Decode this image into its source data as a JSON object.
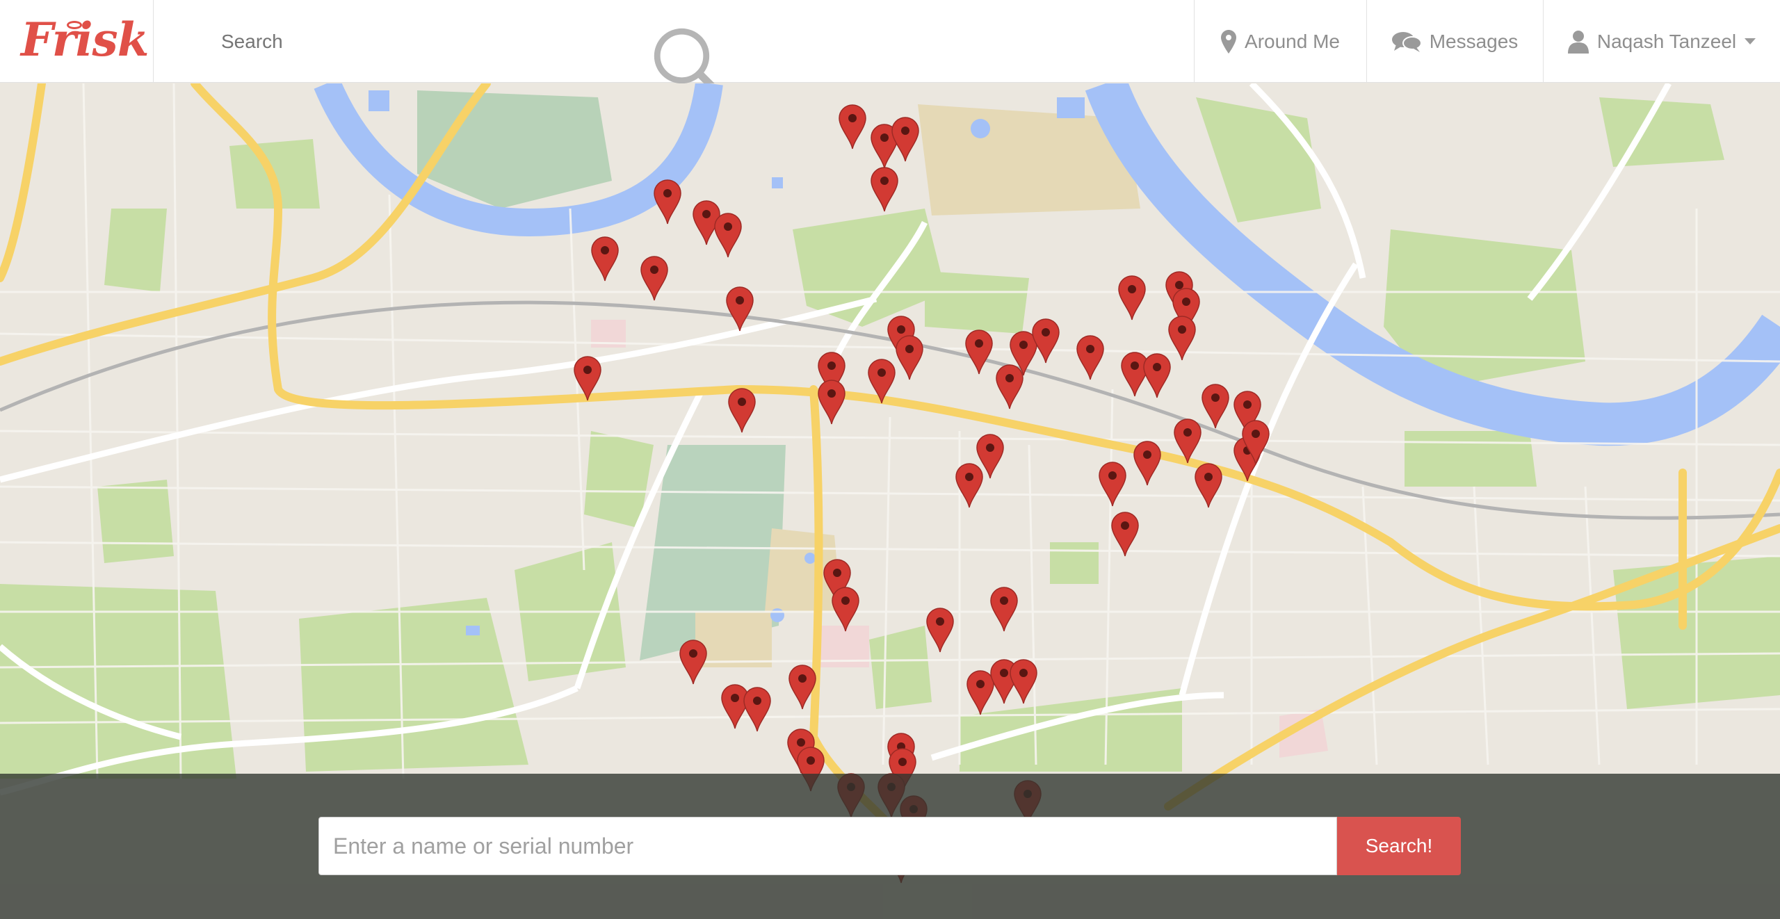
{
  "app": {
    "brand": "Frisk",
    "search_placeholder": "Search"
  },
  "nav": {
    "around_me": "Around Me",
    "messages": "Messages",
    "user_name": "Naqash Tanzeel"
  },
  "finder": {
    "placeholder": "Enter a name or serial number",
    "button_label": "Search!"
  },
  "colors": {
    "brand": "#e05048",
    "marker": "#d23a33",
    "button": "#d9534f",
    "river": "#a4c1f7",
    "park": "#c7dea5",
    "major_road": "#f7d267"
  },
  "icons": [
    "search-icon",
    "map-pin-icon",
    "chat-bubbles-icon",
    "user-icon",
    "caret-down-icon",
    "map-marker-icon"
  ]
}
